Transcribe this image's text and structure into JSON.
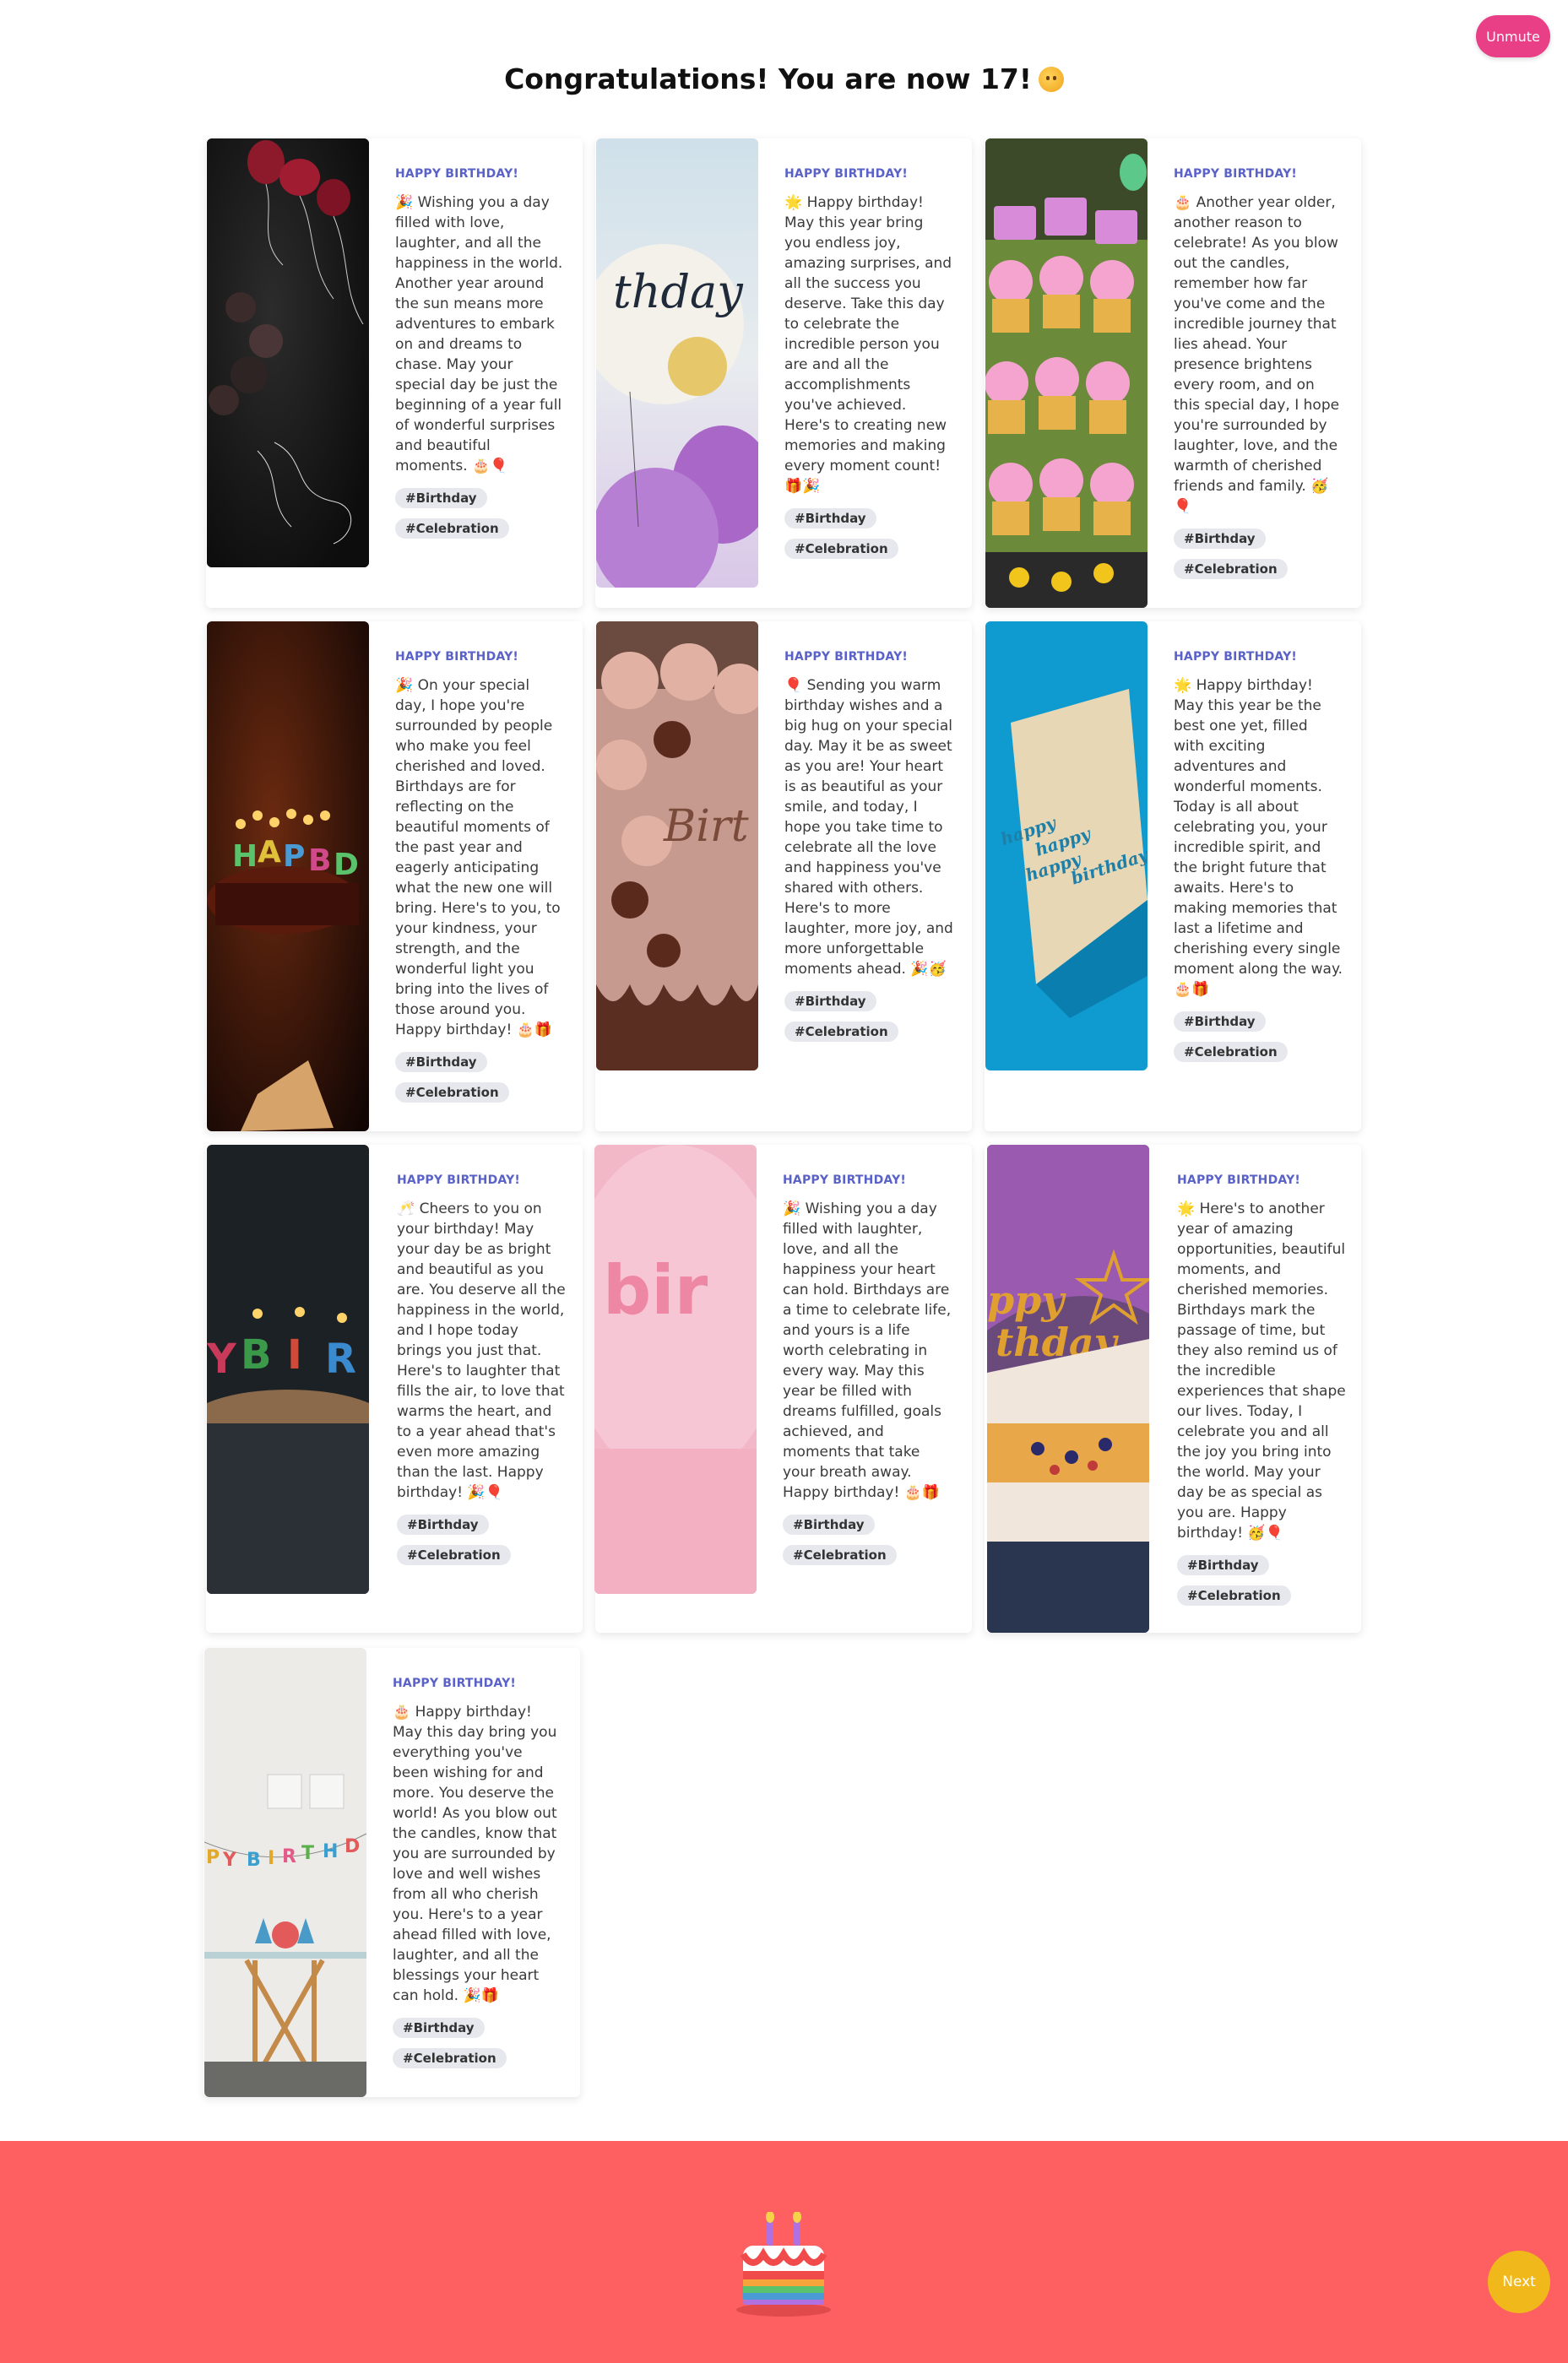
{
  "controls": {
    "unmute_label": "Unmute",
    "next_label": "Next"
  },
  "page": {
    "title": "Congratulations! You are now 17!"
  },
  "cards": [
    {
      "label": "HAPPY BIRTHDAY!",
      "message": "🎉 Wishing you a day filled with love, laughter, and all the happiness in the world. Another year around the sun means more adventures to embark on and dreams to chase. May your special day be just the beginning of a year full of wonderful surprises and beautiful moments. 🎂🎈",
      "tags": [
        "#Birthday",
        "#Celebration"
      ],
      "image": "balloons-on-dark-table-image"
    },
    {
      "label": "HAPPY BIRTHDAY!",
      "message": "🌟 Happy birthday! May this year bring you endless joy, amazing surprises, and all the success you deserve. Take this day to celebrate the incredible person you are and all the accomplishments you've achieved. Here's to creating new memories and making every moment count! 🎁🎉",
      "tags": [
        "#Birthday",
        "#Celebration"
      ],
      "image": "birthday-balloon-sky-image"
    },
    {
      "label": "HAPPY BIRTHDAY!",
      "message": "🎂 Another year older, another reason to celebrate! As you blow out the candles, remember how far you've come and the incredible journey that lies ahead. Your presence brightens every room, and on this special day, I hope you're surrounded by laughter, love, and the warmth of cherished friends and family. 🥳🎈",
      "tags": [
        "#Birthday",
        "#Celebration"
      ],
      "image": "cupcake-tower-image"
    },
    {
      "label": "HAPPY BIRTHDAY!",
      "message": "🎉 On your special day, I hope you're surrounded by people who make you feel cherished and loved. Birthdays are for reflecting on the beautiful moments of the past year and eagerly anticipating what the new one will bring. Here's to you, to your kindness, your strength, and the wonderful light you bring into the lives of those around you. Happy birthday! 🎂🎁",
      "tags": [
        "#Birthday",
        "#Celebration"
      ],
      "image": "cake-with-candles-image"
    },
    {
      "label": "HAPPY BIRTHDAY!",
      "message": "🎈 Sending you warm birthday wishes and a big hug on your special day. May it be as sweet as you are! Your heart is as beautiful as your smile, and today, I hope you take time to celebrate all the love and happiness you've shared with others. Here's to more laughter, more joy, and more unforgettable moments ahead. 🎉🥳",
      "tags": [
        "#Birthday",
        "#Celebration"
      ],
      "image": "chocolate-frosting-cake-image"
    },
    {
      "label": "HAPPY BIRTHDAY!",
      "message": "🌟 Happy birthday! May this year be the best one yet, filled with exciting adventures and wonderful moments. Today is all about celebrating you, your incredible spirit, and the bright future that awaits. Here's to making memories that last a lifetime and cherishing every single moment along the way. 🎂🎁",
      "tags": [
        "#Birthday",
        "#Celebration"
      ],
      "image": "birthday-card-image",
      "card_text": "happy happy happy birthday."
    },
    {
      "label": "HAPPY BIRTHDAY!",
      "message": "🥂 Cheers to you on your birthday! May your day be as bright and beautiful as you are. You deserve all the happiness in the world, and I hope today brings you just that. Here's to laughter that fills the air, to love that warms the heart, and to a year ahead that's even more amazing than the last. Happy birthday! 🎉🎈",
      "tags": [
        "#Birthday",
        "#Celebration"
      ],
      "image": "letter-candles-image"
    },
    {
      "label": "HAPPY BIRTHDAY!",
      "message": "🎉 Wishing you a day filled with laughter, love, and all the happiness your heart can hold. Birthdays are a time to celebrate life, and yours is a life worth celebrating in every way. May this year be filled with dreams fulfilled, goals achieved, and moments that take your breath away. Happy birthday! 🎂🎁",
      "tags": [
        "#Birthday",
        "#Celebration"
      ],
      "image": "pink-birthday-balloon-image"
    },
    {
      "label": "HAPPY BIRTHDAY!",
      "message": "🌟 Here's to another year of amazing opportunities, beautiful moments, and cherished memories. Birthdays mark the passage of time, but they also remind us of the incredible experiences that shape our lives. Today, I celebrate you and all the joy you bring into the world. May your day be as special as you are. Happy birthday! 🥳🎈",
      "tags": [
        "#Birthday",
        "#Celebration"
      ],
      "image": "cake-slice-topper-image"
    },
    {
      "label": "HAPPY BIRTHDAY!",
      "message": "🎂 Happy birthday! May this day bring you everything you've been wishing for and more. You deserve the world! As you blow out the candles, know that you are surrounded by love and well wishes from all who cherish you. Here's to a year ahead filled with love, laughter, and all the blessings your heart can hold. 🎉🎁",
      "tags": [
        "#Birthday",
        "#Celebration"
      ],
      "image": "party-room-banner-image"
    }
  ],
  "colors": {
    "accent": "#5a62c8",
    "unmute": "#e93f86",
    "footer": "#fe6061",
    "next": "#f0b81b"
  }
}
